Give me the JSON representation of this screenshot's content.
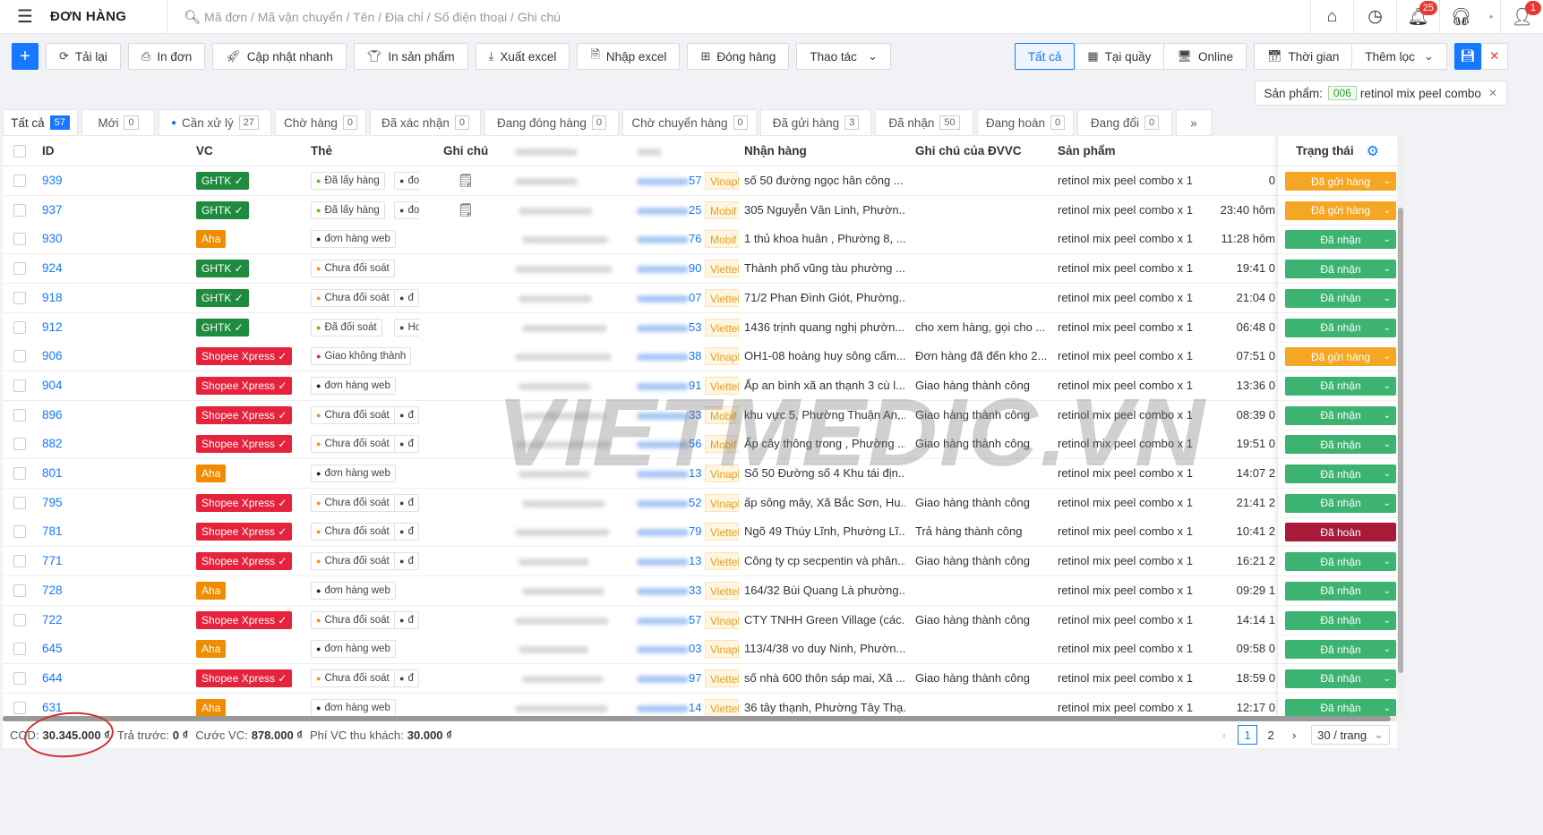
{
  "header": {
    "title": "ĐƠN HÀNG",
    "search_placeholder": "Mã đơn / Mã vận chuyển / Tên / Địa chỉ / Số điện thoại / Ghi chú",
    "notification_count": "25",
    "user_badge": "1"
  },
  "toolbar": {
    "reload": "Tải lại",
    "print_order": "In đơn",
    "quick_update": "Cập nhật nhanh",
    "print_product": "In sản phẩm",
    "export_excel": "Xuất excel",
    "import_excel": "Nhập excel",
    "pack": "Đóng hàng",
    "actions": "Thao tác",
    "all": "Tất cả",
    "at_counter": "Tại quầy",
    "online": "Online",
    "time": "Thời gian",
    "more_filters": "Thêm lọc"
  },
  "filter_chip": {
    "label": "Sản phẩm:",
    "code": "006",
    "value": "retinol mix peel combo"
  },
  "tabs": [
    {
      "label": "Tất cả",
      "count": "57"
    },
    {
      "label": "Mới",
      "count": "0"
    },
    {
      "label": "Cần xử lý",
      "count": "27"
    },
    {
      "label": "Chờ hàng",
      "count": "0"
    },
    {
      "label": "Đã xác nhận",
      "count": "0"
    },
    {
      "label": "Đang đóng hàng",
      "count": "0"
    },
    {
      "label": "Chờ chuyển hàng",
      "count": "0"
    },
    {
      "label": "Đã gửi hàng",
      "count": "3"
    },
    {
      "label": "Đã nhận",
      "count": "50"
    },
    {
      "label": "Đang hoàn",
      "count": "0"
    },
    {
      "label": "Đang đổi",
      "count": "0"
    }
  ],
  "columns": {
    "id": "ID",
    "vc": "VC",
    "tag": "Thẻ",
    "note": "Ghi chú",
    "receiver": "Nhận hàng",
    "carrier_note": "Ghi chú của ĐVVC",
    "product": "Sản phẩm",
    "status": "Trạng thái"
  },
  "colors": {
    "GHTK": "#1e8b3e",
    "Aha": "#f08c00",
    "Shopee Xpress": "#e5233d",
    "accent": "#1677ff"
  },
  "rows": [
    {
      "id": "939",
      "vc": "GHTK ✓",
      "tag": "Đã lấy hàng",
      "tag2": "đơ",
      "note": true,
      "phone_end": "57",
      "net": "Vinapl",
      "address": "số 50 đường ngọc hân công ...",
      "carrier_note": "",
      "product": "retinol mix peel combo x 1",
      "time": "0",
      "status": "Đã gửi hàng"
    },
    {
      "id": "937",
      "vc": "GHTK ✓",
      "tag": "Đã lấy hàng",
      "tag2": "đơ",
      "note": true,
      "phone_end": "25",
      "net": "Mobif",
      "address": "305 Nguyễn Văn Linh, Phườn...",
      "carrier_note": "",
      "product": "retinol mix peel combo x 1",
      "time": "23:40 hôm",
      "status": "Đã gửi hàng"
    },
    {
      "id": "930",
      "vc": "Aha",
      "tag": "đơn hàng web",
      "tag2": "",
      "note": false,
      "phone_end": "76",
      "net": "Mobif",
      "address": "1 thủ khoa huân , Phường 8, ...",
      "carrier_note": "",
      "product": "retinol mix peel combo x 1",
      "time": "11:28 hôm",
      "status": "Đã nhận"
    },
    {
      "id": "924",
      "vc": "GHTK ✓",
      "tag": "Chưa đối soát",
      "tag2": "",
      "note": false,
      "phone_end": "90",
      "net": "Viettel",
      "address": "Thành phố vũng tàu phường ...",
      "carrier_note": "",
      "product": "retinol mix peel combo x 1",
      "time": "19:41 0",
      "status": "Đã nhận"
    },
    {
      "id": "918",
      "vc": "GHTK ✓",
      "tag": "Chưa đối soát",
      "tag2": "đ",
      "note": false,
      "phone_end": "07",
      "net": "Viettel",
      "address": "71/2 Phan Đình Giót, Phường...",
      "carrier_note": "",
      "product": "retinol mix peel combo x 1",
      "time": "21:04 0",
      "status": "Đã nhận"
    },
    {
      "id": "912",
      "vc": "GHTK ✓",
      "tag": "Đã đối soát",
      "tag2": "Hoa",
      "note": false,
      "phone_end": "53",
      "net": "Viettel",
      "address": "1436 trịnh quang nghị phườn...",
      "carrier_note": "cho xem hàng, gọi cho ...",
      "product": "retinol mix peel combo x 1",
      "time": "06:48 0",
      "status": "Đã nhận"
    },
    {
      "id": "906",
      "vc": "Shopee Xpress ✓",
      "tag": "Giao không thành",
      "tag2": "",
      "note": false,
      "phone_end": "38",
      "net": "Vinapl",
      "address": "OH1-08 hoàng huy sông cấm...",
      "carrier_note": "Đơn hàng đã đến kho 2...",
      "product": "retinol mix peel combo x 1",
      "time": "07:51 0",
      "status": "Đã gửi hàng"
    },
    {
      "id": "904",
      "vc": "Shopee Xpress ✓",
      "tag": "đơn hàng web",
      "tag2": "",
      "note": false,
      "phone_end": "91",
      "net": "Viettel",
      "address": "Ấp an bình xã an thạnh 3 cù l...",
      "carrier_note": "Giao hàng thành công",
      "product": "retinol mix peel combo x 1",
      "time": "13:36 0",
      "status": "Đã nhận"
    },
    {
      "id": "896",
      "vc": "Shopee Xpress ✓",
      "tag": "Chưa đối soát",
      "tag2": "đ",
      "note": false,
      "phone_end": "33",
      "net": "Mobif",
      "address": "khu vực 5, Phường Thuận An,...",
      "carrier_note": "Giao hàng thành công",
      "product": "retinol mix peel combo x 1",
      "time": "08:39 0",
      "status": "Đã nhận"
    },
    {
      "id": "882",
      "vc": "Shopee Xpress ✓",
      "tag": "Chưa đối soát",
      "tag2": "đ",
      "note": false,
      "phone_end": "56",
      "net": "Mobif",
      "address": "Ấp cây thông trong , Phường ...",
      "carrier_note": "Giao hàng thành công",
      "product": "retinol mix peel combo x 1",
      "time": "19:51 0",
      "status": "Đã nhận"
    },
    {
      "id": "801",
      "vc": "Aha",
      "tag": "đơn hàng web",
      "tag2": "",
      "note": false,
      "phone_end": "13",
      "net": "Vinapl",
      "address": "Số 50 Đường số 4 Khu tái địn...",
      "carrier_note": "",
      "product": "retinol mix peel combo x 1",
      "time": "14:07 2",
      "status": "Đã nhận"
    },
    {
      "id": "795",
      "vc": "Shopee Xpress ✓",
      "tag": "Chưa đối soát",
      "tag2": "đ",
      "note": false,
      "phone_end": "52",
      "net": "Vinapl",
      "address": "ấp sông mây, Xã Bắc Sơn, Hu...",
      "carrier_note": "Giao hàng thành công",
      "product": "retinol mix peel combo x 1",
      "time": "21:41 2",
      "status": "Đã nhận"
    },
    {
      "id": "781",
      "vc": "Shopee Xpress ✓",
      "tag": "Chưa đối soát",
      "tag2": "đ",
      "note": false,
      "phone_end": "79",
      "net": "Viettel",
      "address": "Ngõ 49 Thúy Lĩnh, Phường Lĩ...",
      "carrier_note": "Trả hàng thành công",
      "product": "retinol mix peel combo x 1",
      "time": "10:41 2",
      "status": "Đã hoàn"
    },
    {
      "id": "771",
      "vc": "Shopee Xpress ✓",
      "tag": "Chưa đối soát",
      "tag2": "đ",
      "note": false,
      "phone_end": "13",
      "net": "Viettel",
      "address": "Công ty cp secpentin và phân...",
      "carrier_note": "Giao hàng thành công",
      "product": "retinol mix peel combo x 1",
      "time": "16:21 2",
      "status": "Đã nhận"
    },
    {
      "id": "728",
      "vc": "Aha",
      "tag": "đơn hàng web",
      "tag2": "",
      "note": false,
      "phone_end": "33",
      "net": "Viettel",
      "address": "164/32 Bùi Quang Là phường...",
      "carrier_note": "",
      "product": "retinol mix peel combo x 1",
      "time": "09:29 1",
      "status": "Đã nhận"
    },
    {
      "id": "722",
      "vc": "Shopee Xpress ✓",
      "tag": "Chưa đối soát",
      "tag2": "đ",
      "note": false,
      "phone_end": "57",
      "net": "Vinapl",
      "address": "CTY TNHH Green Village (các...",
      "carrier_note": "Giao hàng thành công",
      "product": "retinol mix peel combo x 1",
      "time": "14:14 1",
      "status": "Đã nhận"
    },
    {
      "id": "645",
      "vc": "Aha",
      "tag": "đơn hàng web",
      "tag2": "",
      "note": false,
      "phone_end": "03",
      "net": "Vinapl",
      "address": "113/4/38 vo duy Ninh, Phườn...",
      "carrier_note": "",
      "product": "retinol mix peel combo x 1",
      "time": "09:58 0",
      "status": "Đã nhận"
    },
    {
      "id": "644",
      "vc": "Shopee Xpress ✓",
      "tag": "Chưa đối soát",
      "tag2": "đ",
      "note": false,
      "phone_end": "97",
      "net": "Viettel",
      "address": "số nhà 600 thôn sáp mai, Xã ...",
      "carrier_note": "Giao hàng thành công",
      "product": "retinol mix peel combo x 1",
      "time": "18:59 0",
      "status": "Đã nhận"
    },
    {
      "id": "631",
      "vc": "Aha",
      "tag": "đơn hàng web",
      "tag2": "",
      "note": false,
      "phone_end": "14",
      "net": "Viettel",
      "address": "36 tây thạnh, Phường Tây Thạ...",
      "carrier_note": "",
      "product": "retinol mix peel combo x 1",
      "time": "12:17 0",
      "status": "Đã nhận"
    }
  ],
  "watermark": "VIETMEDIC.VN",
  "footer": {
    "cod_label": "COD:",
    "cod_value": "30.345.000 ₫",
    "prepaid_label": "Trả trước:",
    "prepaid_value": "0 ₫",
    "shipping_label": "Cước VC:",
    "shipping_value": "878.000 ₫",
    "fee_label": "Phí VC thu khách:",
    "fee_value": "30.000 ₫",
    "page1": "1",
    "page2": "2",
    "page_size": "30 / trang"
  }
}
